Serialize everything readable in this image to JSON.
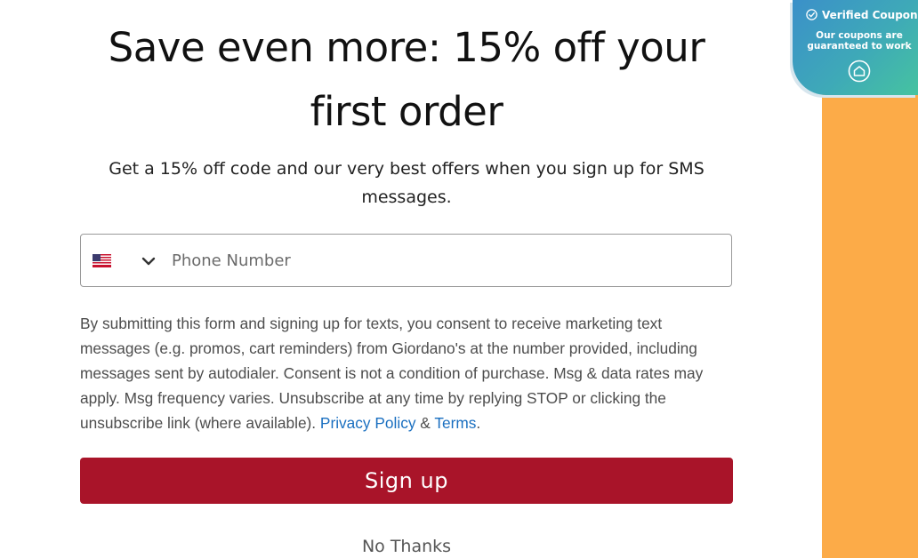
{
  "modal": {
    "title": "Save even more: 15% off your first order",
    "subtitle": "Get a 15% off code and our very best offers when you sign up for SMS messages.",
    "phone": {
      "country": "United States",
      "placeholder": "Phone Number",
      "value": ""
    },
    "consent": {
      "text": "By submitting this form and signing up for texts, you consent to receive marketing text messages (e.g. promos, cart reminders) from Giordano's at the number provided, including messages sent by autodialer. Consent is not a condition of purchase. Msg & data rates may apply. Msg frequency varies. Unsubscribe at any time by replying STOP or clicking the unsubscribe link (where available). ",
      "privacy_link": "Privacy Policy",
      "joiner": " & ",
      "terms_link": "Terms",
      "end": "."
    },
    "signup_label": "Sign up",
    "no_thanks_label": "No Thanks"
  },
  "badge": {
    "title": "Verified Coupon",
    "text": "Our coupons are guaranteed to work",
    "icon": "house-icon"
  },
  "colors": {
    "signup_button": "#a91429",
    "link": "#1a6fc0",
    "side_panel": "#fcab48",
    "badge_gradient_start": "#3b90c9",
    "badge_gradient_end": "#46c3a0"
  }
}
